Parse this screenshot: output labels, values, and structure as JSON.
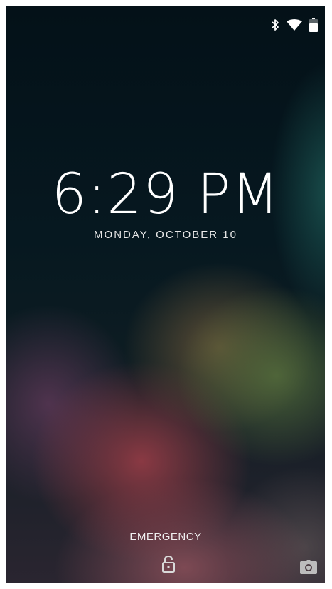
{
  "status_bar": {
    "icons": [
      "bluetooth-icon",
      "wifi-icon",
      "battery-icon"
    ]
  },
  "lockscreen": {
    "time": "6:29 PM",
    "date": "MONDAY, OCTOBER 10",
    "emergency_label": "EMERGENCY"
  },
  "bottom_actions": {
    "lock_icon": "unlock-icon",
    "camera_icon": "camera-icon"
  },
  "colors": {
    "text": "#ffffff",
    "background": "#05141b"
  }
}
